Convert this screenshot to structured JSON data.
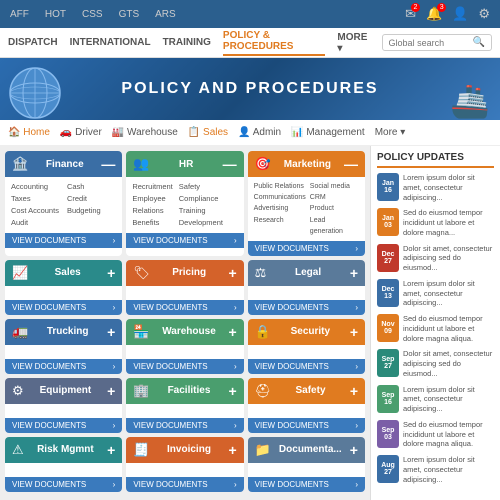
{
  "top_nav": {
    "items": [
      "AFF",
      "HOT",
      "CSS",
      "GTS",
      "ARS"
    ]
  },
  "second_nav": {
    "items": [
      "DISPATCH",
      "INTERNATIONAL",
      "TRAINING",
      "POLICY & PROCEDURES",
      "MORE ▾"
    ],
    "active": "POLICY & PROCEDURES",
    "search_placeholder": "Global search"
  },
  "hero": {
    "title": "POLICY AND PROCEDURES"
  },
  "sub_nav": {
    "items": [
      {
        "label": "Home",
        "icon": "🏠",
        "active": true
      },
      {
        "label": "Driver",
        "icon": "🚗"
      },
      {
        "label": "Warehouse",
        "icon": "🏭"
      },
      {
        "label": "Sales",
        "icon": "📋"
      },
      {
        "label": "Admin",
        "icon": "👤"
      },
      {
        "label": "Management",
        "icon": "📊"
      },
      {
        "label": "More ▾",
        "icon": ""
      }
    ]
  },
  "cards": [
    {
      "id": "finance",
      "title": "Finance",
      "icon": "🏦",
      "color": "bg-blue",
      "cols": [
        [
          "Accounting",
          "Taxes",
          "Cost Accounts",
          "Audit"
        ],
        [
          "Cash",
          "Credit",
          "Budgeting"
        ]
      ],
      "footer": "VIEW DOCUMENTS",
      "plus": false
    },
    {
      "id": "hr",
      "title": "HR",
      "icon": "👥",
      "color": "bg-green",
      "cols": [
        [
          "Recruitment",
          "Employee Relations",
          "Benefits"
        ],
        [
          "Safety",
          "Compliance",
          "Training",
          "Development"
        ]
      ],
      "footer": "VIEW DOCUMENTS",
      "plus": false
    },
    {
      "id": "marketing",
      "title": "Marketing",
      "icon": "🎯",
      "color": "bg-orange",
      "cols": [
        [
          "Public Relations",
          "Communications",
          "Advertising",
          "Research"
        ],
        [
          "Social media",
          "CRM",
          "Product",
          "Lead generation"
        ]
      ],
      "footer": "VIEW DOCUMENTS",
      "plus": false
    },
    {
      "id": "sales",
      "title": "Sales",
      "icon": "📈",
      "color": "bg-teal",
      "cols": [],
      "footer": "VIEW DOCUMENTS",
      "plus": true
    },
    {
      "id": "pricing",
      "title": "Pricing",
      "icon": "🏷",
      "color": "bg-red-orange",
      "cols": [],
      "footer": "VIEW DOCUMENTS",
      "plus": true
    },
    {
      "id": "legal",
      "title": "Legal",
      "icon": "⚖",
      "color": "bg-gray-blue",
      "cols": [],
      "footer": "VIEW DOCUMENTS",
      "plus": true
    },
    {
      "id": "trucking",
      "title": "Trucking",
      "icon": "🚛",
      "color": "bg-blue",
      "cols": [],
      "footer": "VIEW DOCUMENTS",
      "plus": true
    },
    {
      "id": "warehouse",
      "title": "Warehouse",
      "icon": "🏪",
      "color": "bg-green",
      "cols": [],
      "footer": "VIEW DOCUMENTS",
      "plus": true
    },
    {
      "id": "security",
      "title": "Security",
      "icon": "🔒",
      "color": "bg-orange",
      "cols": [],
      "footer": "VIEW DOCUMENTS",
      "plus": true
    },
    {
      "id": "equipment",
      "title": "Equipment",
      "icon": "⚙",
      "color": "bg-steel",
      "cols": [],
      "footer": "VIEW DOCUMENTS",
      "plus": true
    },
    {
      "id": "facilities",
      "title": "Facilities",
      "icon": "🏢",
      "color": "bg-green",
      "cols": [],
      "footer": "VIEW DOCUMENTS",
      "plus": true
    },
    {
      "id": "safety",
      "title": "Safety",
      "icon": "⛑",
      "color": "bg-orange",
      "cols": [],
      "footer": "VIEW DOCUMENTS",
      "plus": true
    },
    {
      "id": "risk-mgmt",
      "title": "Risk Mgmnt",
      "icon": "⚠",
      "color": "bg-teal",
      "cols": [],
      "footer": "VIEW DOCUMENTS",
      "plus": true
    },
    {
      "id": "invoicing",
      "title": "Invoicing",
      "icon": "🧾",
      "color": "bg-red-orange",
      "cols": [],
      "footer": "VIEW DOCUMENTS",
      "plus": true
    },
    {
      "id": "documenta",
      "title": "Documenta...",
      "icon": "📁",
      "color": "bg-gray-blue",
      "cols": [],
      "footer": "VIEW DOCUMENTS",
      "plus": true
    }
  ],
  "policy_updates": {
    "title": "POLICY UPDATES",
    "items": [
      {
        "month": "Jan",
        "day": "16",
        "color": "date-blue",
        "text": "Lorem ipsum dolor sit amet, consectetur adipiscing..."
      },
      {
        "month": "Jan",
        "day": "03",
        "color": "date-orange",
        "text": "Sed do eiusmod tempor incididunt ut labore et dolore magna..."
      },
      {
        "month": "Dec",
        "day": "27",
        "color": "date-red",
        "text": "Dolor sit amet, consectetur adipiscing sed do eiusmod..."
      },
      {
        "month": "Dec",
        "day": "13",
        "color": "date-blue",
        "text": "Lorem ipsum dolor sit amet, consectetur adipiscing..."
      },
      {
        "month": "Nov",
        "day": "09",
        "color": "date-orange",
        "text": "Sed do eiusmod tempor incididunt ut labore et dolore magna aliqua."
      },
      {
        "month": "Sep",
        "day": "27",
        "color": "date-teal",
        "text": "Dolor sit amet, consectetur adipiscing sed do eiusmod..."
      },
      {
        "month": "Sep",
        "day": "16",
        "color": "date-green",
        "text": "Lorem ipsum dolor sit amet, consectetur adipiscing..."
      },
      {
        "month": "Sep",
        "day": "03",
        "color": "date-purple",
        "text": "Sed do eiusmod tempor incididunt ut labore et dolore magna aliqua."
      },
      {
        "month": "Aug",
        "day": "27",
        "color": "date-blue",
        "text": "Lorem ipsum dolor sit amet, consectetur adipiscing..."
      }
    ]
  }
}
